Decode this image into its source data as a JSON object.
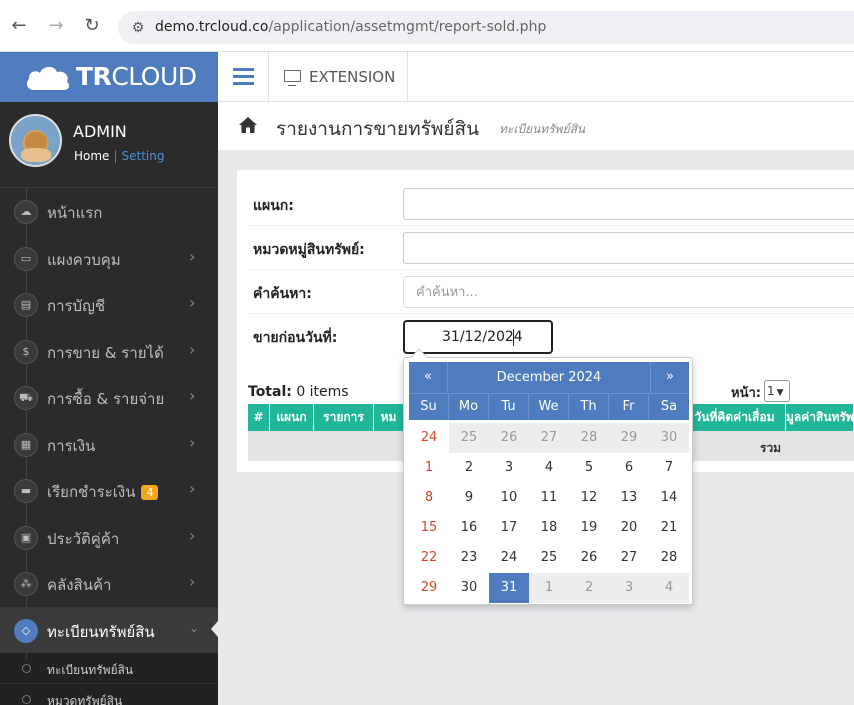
{
  "browser": {
    "url_host": "demo.trcloud.co",
    "url_path": "/application/assetmgmt/report-sold.php"
  },
  "brand": {
    "bold": "TR",
    "light": "CLOUD"
  },
  "user": {
    "name": "ADMIN",
    "home": "Home",
    "separator": "|",
    "setting": "Setting"
  },
  "menu": [
    {
      "label": "หน้าแรก",
      "icon": "cloud-icon",
      "glyph": "☁",
      "arrow": false
    },
    {
      "label": "แผงควบคุม",
      "icon": "monitor-icon",
      "glyph": "▭",
      "arrow": true
    },
    {
      "label": "การบัญชี",
      "icon": "book-icon",
      "glyph": "▤",
      "arrow": true
    },
    {
      "label": "การขาย & รายได้",
      "icon": "dollar-icon",
      "glyph": "$",
      "arrow": true
    },
    {
      "label": "การซื้อ & รายจ่าย",
      "icon": "cart-icon",
      "glyph": "⛟",
      "arrow": true
    },
    {
      "label": "การเงิน",
      "icon": "calendar-icon",
      "glyph": "▦",
      "arrow": true
    },
    {
      "label": "เรียกชำระเงิน",
      "icon": "credit-card-icon",
      "glyph": "▬",
      "arrow": true,
      "badge": "4"
    },
    {
      "label": "ประวัติคู่ค้า",
      "icon": "contact-book-icon",
      "glyph": "▣",
      "arrow": true
    },
    {
      "label": "คลังสินค้า",
      "icon": "cubes-icon",
      "glyph": "⁂",
      "arrow": true
    },
    {
      "label": "ทะเบียนทรัพย์สิน",
      "icon": "diamond-icon",
      "glyph": "◇",
      "arrow": true,
      "active": true
    }
  ],
  "submenu": [
    {
      "label": "ทะเบียนทรัพย์สิน"
    },
    {
      "label": "หมวดทรัพย์สิน"
    }
  ],
  "topbar": {
    "extension": "EXTENSION"
  },
  "page": {
    "title": "รายงานการขายทรัพย์สิน",
    "subtitle": "ทะเบียนทรัพย์สิน"
  },
  "form": {
    "department_label": "แผนก:",
    "category_label": "หมวดหมู่สินทรัพย์:",
    "search_label": "คำค้นหา:",
    "search_placeholder": "คำค้นหา...",
    "sold_before_label": "ขายก่อนวันที่:",
    "sold_before_value": "31/12/2024"
  },
  "list": {
    "total_label": "Total:",
    "total_value": "0 items",
    "page_label": "หน้า:",
    "page_value": "1",
    "columns": [
      "#",
      "แผนก",
      "รายการ",
      "หม",
      "วันที่คิดค่าเสื่อม",
      "มูลค่าสินทรัพ"
    ],
    "sum_label": "รวม"
  },
  "datepicker": {
    "prev": "«",
    "next": "»",
    "title": "December 2024",
    "dow": [
      "Su",
      "Mo",
      "Tu",
      "We",
      "Th",
      "Fr",
      "Sa"
    ],
    "weeks": [
      [
        {
          "d": "24",
          "o": false,
          "s": true
        },
        {
          "d": "25",
          "o": true
        },
        {
          "d": "26",
          "o": true
        },
        {
          "d": "27",
          "o": true
        },
        {
          "d": "28",
          "o": true
        },
        {
          "d": "29",
          "o": true
        },
        {
          "d": "30",
          "o": true
        }
      ],
      [
        {
          "d": "1",
          "s": true
        },
        {
          "d": "2"
        },
        {
          "d": "3"
        },
        {
          "d": "4"
        },
        {
          "d": "5"
        },
        {
          "d": "6"
        },
        {
          "d": "7"
        }
      ],
      [
        {
          "d": "8",
          "s": true
        },
        {
          "d": "9"
        },
        {
          "d": "10"
        },
        {
          "d": "11"
        },
        {
          "d": "12"
        },
        {
          "d": "13"
        },
        {
          "d": "14"
        }
      ],
      [
        {
          "d": "15",
          "s": true
        },
        {
          "d": "16"
        },
        {
          "d": "17"
        },
        {
          "d": "18"
        },
        {
          "d": "19"
        },
        {
          "d": "20"
        },
        {
          "d": "21"
        }
      ],
      [
        {
          "d": "22",
          "s": true
        },
        {
          "d": "23"
        },
        {
          "d": "24"
        },
        {
          "d": "25"
        },
        {
          "d": "26"
        },
        {
          "d": "27"
        },
        {
          "d": "28"
        }
      ],
      [
        {
          "d": "29",
          "s": true
        },
        {
          "d": "30"
        },
        {
          "d": "31",
          "sel": true
        },
        {
          "d": "1",
          "o": true
        },
        {
          "d": "2",
          "o": true
        },
        {
          "d": "3",
          "o": true
        },
        {
          "d": "4",
          "o": true
        }
      ]
    ]
  },
  "colors": {
    "brand": "#4e7cbf",
    "table_header": "#21b69a",
    "sunday": "#d9452c",
    "badge": "#f0a81a"
  }
}
